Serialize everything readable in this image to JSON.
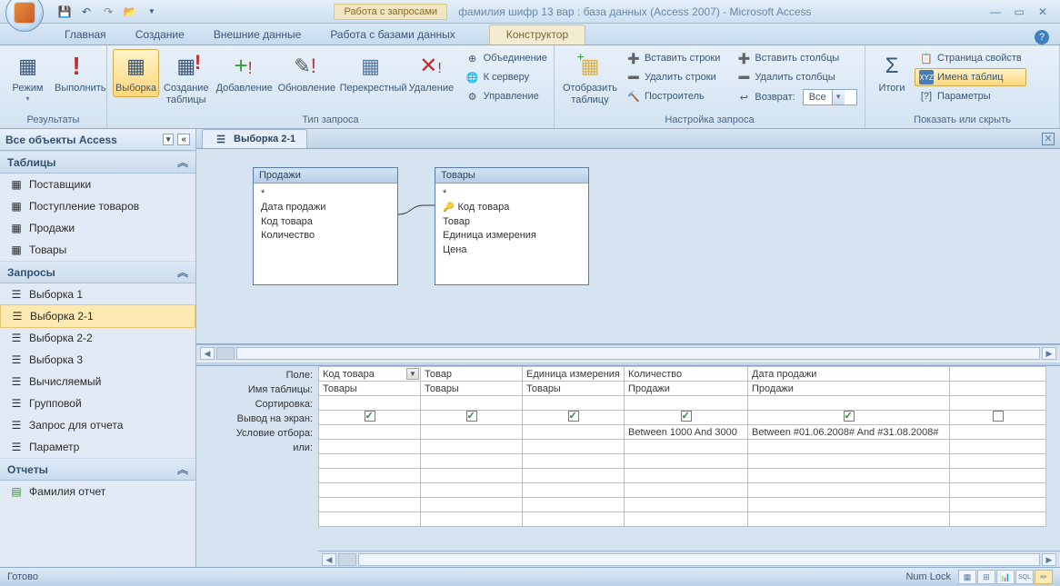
{
  "title": {
    "context_tab_group": "Работа с запросами",
    "db_title": "фамилия шифр 13 вар : база данных (Access 2007) - Microsoft Access"
  },
  "tabs": {
    "home": "Главная",
    "create": "Создание",
    "external": "Внешние данные",
    "dbtools": "Работа с базами данных",
    "design": "Конструктор"
  },
  "ribbon": {
    "g_results": "Результаты",
    "view": "Режим",
    "run": "Выполнить",
    "g_qtype": "Тип запроса",
    "select": "Выборка",
    "maketable": "Создание таблицы",
    "append": "Добавление",
    "update": "Обновление",
    "crosstab": "Перекрестный",
    "delete": "Удаление",
    "union": "Объединение",
    "passthrough": "К серверу",
    "datadef": "Управление",
    "g_setup": "Настройка запроса",
    "showtable": "Отобразить таблицу",
    "insrows": "Вставить строки",
    "delrows": "Удалить строки",
    "builder": "Построитель",
    "inscols": "Вставить столбцы",
    "delcols": "Удалить столбцы",
    "return": "Возврат:",
    "return_val": "Все",
    "g_showhide": "Показать или скрыть",
    "totals": "Итоги",
    "propsheet": "Страница свойств",
    "tablenames": "Имена таблиц",
    "params": "Параметры"
  },
  "nav": {
    "header": "Все объекты Access",
    "sec_tables": "Таблицы",
    "t1": "Поставщики",
    "t2": "Поступление товаров",
    "t3": "Продажи",
    "t4": "Товары",
    "sec_queries": "Запросы",
    "q1": "Выборка 1",
    "q2": "Выборка 2-1",
    "q3": "Выборка 2-2",
    "q4": "Выборка 3",
    "q5": "Вычисляемый",
    "q6": "Групповой",
    "q7": "Запрос для отчета",
    "q8": "Параметр",
    "sec_reports": "Отчеты",
    "r1": "Фамилия отчет"
  },
  "doc": {
    "tab": "Выборка 2-1"
  },
  "tbl_sales": {
    "title": "Продажи",
    "star": "*",
    "f1": "Дата продажи",
    "f2": "Код товара",
    "f3": "Количество"
  },
  "tbl_goods": {
    "title": "Товары",
    "star": "*",
    "f1": "Код товара",
    "f2": "Товар",
    "f3": "Единица измерения",
    "f4": "Цена"
  },
  "gridlabels": {
    "field": "Поле:",
    "table": "Имя таблицы:",
    "sort": "Сортировка:",
    "show": "Вывод на экран:",
    "criteria": "Условие отбора:",
    "or": "или:"
  },
  "grid": {
    "c1": {
      "field": "Код товара",
      "table": "Товары"
    },
    "c2": {
      "field": "Товар",
      "table": "Товары"
    },
    "c3": {
      "field": "Единица измерения",
      "table": "Товары"
    },
    "c4": {
      "field": "Количество",
      "table": "Продажи",
      "crit": "Between 1000 And 3000"
    },
    "c5": {
      "field": "Дата продажи",
      "table": "Продажи",
      "crit": "Between #01.06.2008# And #31.08.2008#"
    }
  },
  "status": {
    "ready": "Готово",
    "numlock": "Num Lock"
  }
}
